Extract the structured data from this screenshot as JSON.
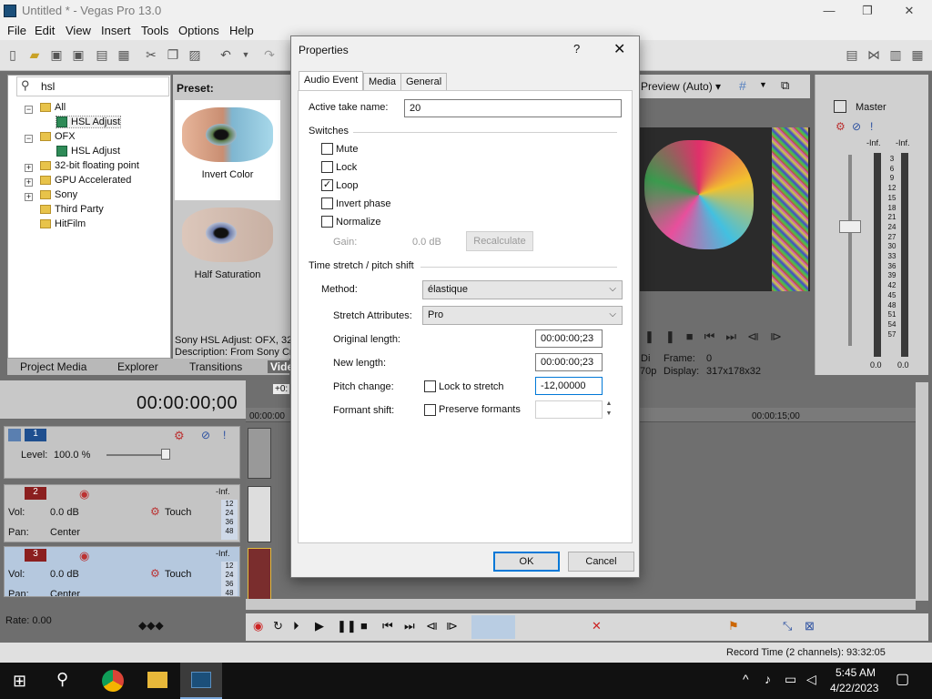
{
  "window": {
    "title": "Untitled * - Vegas Pro 13.0",
    "minimize": "—",
    "restore": "❐",
    "close": "✕"
  },
  "menu": [
    "File",
    "Edit",
    "View",
    "Insert",
    "Tools",
    "Options",
    "Help"
  ],
  "explorer": {
    "search_value": "hsl",
    "tree": [
      {
        "label": "All",
        "type": "folder",
        "expanded": true
      },
      {
        "label": "HSL Adjust",
        "type": "fx",
        "selected": true
      },
      {
        "label": "OFX",
        "type": "folder",
        "expanded": true
      },
      {
        "label": "HSL Adjust",
        "type": "fx"
      },
      {
        "label": "32-bit floating point",
        "type": "folder"
      },
      {
        "label": "GPU Accelerated",
        "type": "folder"
      },
      {
        "label": "Sony",
        "type": "folder"
      },
      {
        "label": "Third Party",
        "type": "folder"
      },
      {
        "label": "HitFilm",
        "type": "folder"
      }
    ]
  },
  "preset": {
    "heading": "Preset:",
    "items": [
      "Invert Color",
      "Half Saturation"
    ],
    "info_line1": "Sony HSL Adjust: OFX, 32-",
    "info_line2": "Description: From Sony Cre"
  },
  "bottom_tabs": [
    "Project Media",
    "Explorer",
    "Transitions",
    "Vide"
  ],
  "preview": {
    "mode": "Preview (Auto)",
    "frame_label": "Frame:",
    "frame_value": "0",
    "display_label": "Display:",
    "display_value": "317x178x32",
    "res_fragment": "70p",
    "di_fragment": "Di"
  },
  "master": {
    "title": "Master",
    "inf_left": "-Inf.",
    "inf_right": "-Inf.",
    "scale": [
      "3",
      "6",
      "9",
      "12",
      "15",
      "18",
      "21",
      "24",
      "27",
      "30",
      "33",
      "36",
      "39",
      "42",
      "45",
      "48",
      "51",
      "54",
      "57"
    ],
    "bottom_left": "0.0",
    "bottom_right": "0.0"
  },
  "timeline": {
    "timecode": "00:00:00;00",
    "ruler_start": "00:00:00",
    "ruler_mark": "00:00:15;00",
    "offset": "+0:",
    "tracks": [
      {
        "num": "1",
        "level_label": "Level:",
        "level_value": "100.0 %"
      },
      {
        "num": "2",
        "vol_label": "Vol:",
        "vol_value": "0.0 dB",
        "pan_label": "Pan:",
        "pan_value": "Center",
        "mode": "Touch",
        "inf": "-Inf.",
        "scale": [
          "12",
          "24",
          "36",
          "48"
        ]
      },
      {
        "num": "3",
        "vol_label": "Vol:",
        "vol_value": "0.0 dB",
        "pan_label": "Pan:",
        "pan_value": "Center",
        "mode": "Touch",
        "inf": "-Inf.",
        "scale": [
          "12",
          "24",
          "36",
          "48"
        ]
      }
    ],
    "rate": "Rate: 0.00"
  },
  "status": {
    "record_time": "Record Time (2 channels): 93:32:05"
  },
  "taskbar": {
    "time": "5:45 AM",
    "date": "4/22/2023"
  },
  "dialog": {
    "title": "Properties",
    "help": "?",
    "close": "✕",
    "tabs": [
      "Audio Event",
      "Media",
      "General"
    ],
    "active_take_label": "Active take name:",
    "active_take_value": "20",
    "switches_heading": "Switches",
    "switches": [
      {
        "label": "Mute",
        "checked": false
      },
      {
        "label": "Lock",
        "checked": false
      },
      {
        "label": "Loop",
        "checked": true
      },
      {
        "label": "Invert phase",
        "checked": false
      },
      {
        "label": "Normalize",
        "checked": false
      }
    ],
    "gain_label": "Gain:",
    "gain_value": "0.0 dB",
    "recalculate": "Recalculate",
    "stretch_heading": "Time stretch / pitch shift",
    "method_label": "Method:",
    "method_value": "élastique",
    "stretch_attr_label": "Stretch Attributes:",
    "stretch_attr_value": "Pro",
    "orig_len_label": "Original length:",
    "orig_len_value": "00:00:00;23",
    "new_len_label": "New length:",
    "new_len_value": "00:00:00;23",
    "pitch_label": "Pitch change:",
    "lock_stretch_label": "Lock to stretch",
    "pitch_value": "-12,00000",
    "formant_label": "Formant shift:",
    "preserve_formants_label": "Preserve formants",
    "ok": "OK",
    "cancel": "Cancel"
  }
}
